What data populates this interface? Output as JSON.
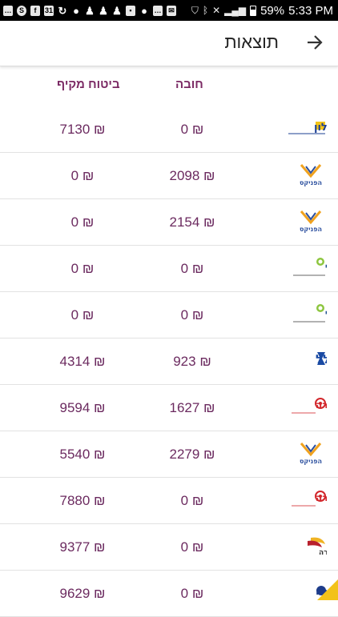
{
  "statusbar": {
    "notification_icons": [
      "message-icon",
      "skype-icon",
      "facebook-icon",
      "calendar-icon",
      "sync-icon",
      "pin-icon",
      "person-icon",
      "person-icon",
      "person-icon",
      "image-icon",
      "pin-icon",
      "message-icon",
      "mail-icon"
    ],
    "calendar_day": "31",
    "battery": "59%",
    "battery_level": 0.59,
    "time": "5:33 PM"
  },
  "header": {
    "title": "תוצאות"
  },
  "columns": {
    "mandatory": "חובה",
    "comprehensive": "ביטוח מקיף"
  },
  "rows": [
    {
      "company": "איילון",
      "logo_icon": "ayalon-logo-icon",
      "mandatory": "₪ 0",
      "comprehensive": "₪ 7130"
    },
    {
      "company": "הפניקס",
      "logo_icon": "phoenix-logo-icon",
      "mandatory": "₪ 2098",
      "comprehensive": "₪ 0"
    },
    {
      "company": "הפניקס",
      "logo_icon": "phoenix-logo-icon",
      "mandatory": "₪ 2154",
      "comprehensive": "₪ 0"
    },
    {
      "company": "הראל",
      "logo_icon": "harel-logo-icon",
      "mandatory": "₪ 0",
      "comprehensive": "₪ 0"
    },
    {
      "company": "הראל",
      "logo_icon": "harel-logo-icon",
      "mandatory": "₪ 0",
      "comprehensive": "₪ 0"
    },
    {
      "company": "כלל",
      "logo_icon": "clal-logo-icon",
      "mandatory": "₪ 923",
      "comprehensive": "₪ 4314"
    },
    {
      "company": "הכשרה",
      "logo_icon": "hachshara-logo-icon",
      "mandatory": "₪ 1627",
      "comprehensive": "₪ 9594"
    },
    {
      "company": "הפניקס",
      "logo_icon": "phoenix-logo-icon",
      "mandatory": "₪ 2279",
      "comprehensive": "₪ 5540"
    },
    {
      "company": "הכשרה",
      "logo_icon": "hachshara-logo-icon",
      "mandatory": "₪ 0",
      "comprehensive": "₪ 7880"
    },
    {
      "company": "מנורה",
      "logo_icon": "menora-logo-icon",
      "mandatory": "₪ 0",
      "comprehensive": "₪ 9377"
    },
    {
      "company": "שומרה",
      "logo_icon": "shomera-logo-icon",
      "mandatory": "₪ 0",
      "comprehensive": "₪ 9629"
    }
  ],
  "colors": {
    "value_text": "#6b2a5f",
    "header_text": "#7b2a64",
    "ayalon": "#1c3f94",
    "phoenix": "#f0a21e",
    "harel": "#1d4f8f",
    "clal": "#1a4aa3",
    "hachshara": "#d2262b",
    "menora": "#b8202c",
    "shomera": "#1d3c8a"
  }
}
